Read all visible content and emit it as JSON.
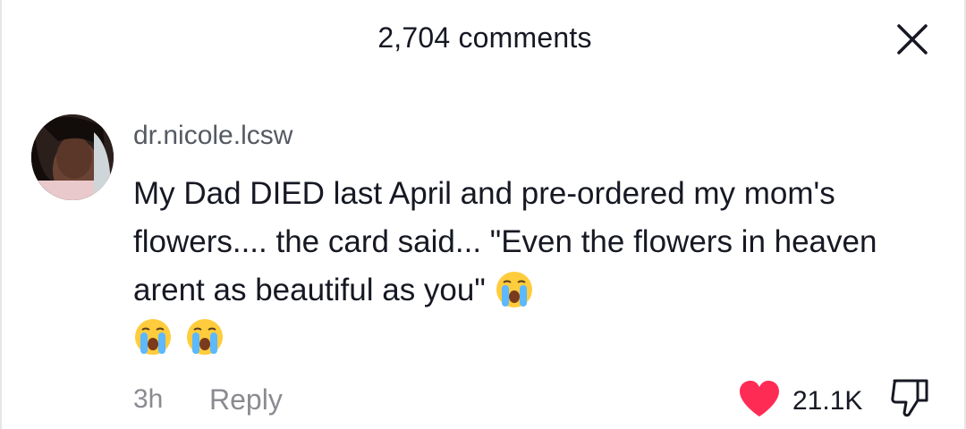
{
  "header": {
    "title": "2,704 comments",
    "close_icon": "close-icon"
  },
  "comment": {
    "username": "dr.nicole.lcsw",
    "avatar_icon": "avatar",
    "text": "My Dad DIED last April and pre-ordered my mom's flowers.... the card said... \"Even the flowers in heaven arent as beautiful as you\"",
    "emojis": [
      "loudly-crying-face-icon",
      "loudly-crying-face-icon",
      "loudly-crying-face-icon"
    ],
    "timestamp": "3h",
    "reply_label": "Reply",
    "like_count": "21.1K",
    "liked": true,
    "like_color": "#fe2c55"
  }
}
